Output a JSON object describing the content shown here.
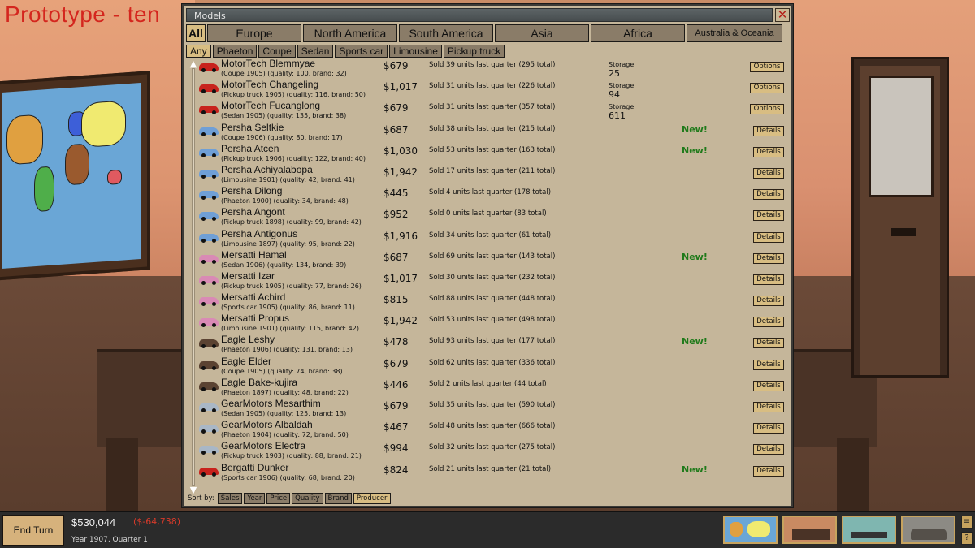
{
  "background_title": "Prototype - ten",
  "window": {
    "title": "Models",
    "close_symbol": "✕"
  },
  "regions": [
    {
      "label": "All",
      "active": true
    },
    {
      "label": "Europe",
      "active": false
    },
    {
      "label": "North America",
      "active": false
    },
    {
      "label": "South America",
      "active": false
    },
    {
      "label": "Asia",
      "active": false
    },
    {
      "label": "Africa",
      "active": false
    },
    {
      "label": "Australia & Oceania",
      "active": false
    }
  ],
  "types": [
    {
      "label": "Any",
      "active": true
    },
    {
      "label": "Phaeton",
      "active": false
    },
    {
      "label": "Coupe",
      "active": false
    },
    {
      "label": "Sedan",
      "active": false
    },
    {
      "label": "Sports car",
      "active": false
    },
    {
      "label": "Limousine",
      "active": false
    },
    {
      "label": "Pickup truck",
      "active": false
    }
  ],
  "scroll": {
    "up": "▲",
    "down": "▼"
  },
  "models": [
    {
      "name": "MotorTech Blemmyae",
      "sub": "(Coupe 1905)   (quality: 100, brand: 32)",
      "price": "$679",
      "sold": "Sold 39 units last quarter (295 total)",
      "storage_label": "Storage",
      "storage": "25",
      "new": "",
      "button": "Options",
      "icon_color": "#c8231d"
    },
    {
      "name": "MotorTech Changeling",
      "sub": "(Pickup truck 1905)   (quality: 116, brand: 50)",
      "price": "$1,017",
      "sold": "Sold 31 units last quarter (226 total)",
      "storage_label": "Storage",
      "storage": "94",
      "new": "",
      "button": "Options",
      "icon_color": "#c8231d"
    },
    {
      "name": "MotorTech Fucanglong",
      "sub": "(Sedan 1905)   (quality: 135, brand: 38)",
      "price": "$679",
      "sold": "Sold 31 units last quarter (357 total)",
      "storage_label": "Storage",
      "storage": "611",
      "new": "",
      "button": "Options",
      "icon_color": "#c8231d"
    },
    {
      "name": "Persha Seltkie",
      "sub": "(Coupe 1906)   (quality: 80, brand: 17)",
      "price": "$687",
      "sold": "Sold 38 units last quarter (215 total)",
      "storage_label": "",
      "storage": "",
      "new": "New!",
      "button": "Details",
      "icon_color": "#6f9fd6"
    },
    {
      "name": "Persha Atcen",
      "sub": "(Pickup truck 1906)   (quality: 122, brand: 40)",
      "price": "$1,030",
      "sold": "Sold 53 units last quarter (163 total)",
      "storage_label": "",
      "storage": "",
      "new": "New!",
      "button": "Details",
      "icon_color": "#6f9fd6"
    },
    {
      "name": "Persha Achiyalabopa",
      "sub": "(Limousine 1901)   (quality: 42, brand: 41)",
      "price": "$1,942",
      "sold": "Sold 17 units last quarter (211 total)",
      "storage_label": "",
      "storage": "",
      "new": "",
      "button": "Details",
      "icon_color": "#6f9fd6"
    },
    {
      "name": "Persha Dilong",
      "sub": "(Phaeton 1900)   (quality: 34, brand: 48)",
      "price": "$445",
      "sold": "Sold 4 units last quarter (178 total)",
      "storage_label": "",
      "storage": "",
      "new": "",
      "button": "Details",
      "icon_color": "#6f9fd6"
    },
    {
      "name": "Persha Angont",
      "sub": "(Pickup truck 1898)   (quality: 99, brand: 42)",
      "price": "$952",
      "sold": "Sold 0 units last quarter (83 total)",
      "storage_label": "",
      "storage": "",
      "new": "",
      "button": "Details",
      "icon_color": "#6f9fd6"
    },
    {
      "name": "Persha Antigonus",
      "sub": "(Limousine 1897)   (quality: 95, brand: 22)",
      "price": "$1,916",
      "sold": "Sold 34 units last quarter (61 total)",
      "storage_label": "",
      "storage": "",
      "new": "",
      "button": "Details",
      "icon_color": "#6f9fd6"
    },
    {
      "name": "Mersatti Hamal",
      "sub": "(Sedan 1906)   (quality: 134, brand: 39)",
      "price": "$687",
      "sold": "Sold 69 units last quarter (143 total)",
      "storage_label": "",
      "storage": "",
      "new": "New!",
      "button": "Details",
      "icon_color": "#d98ab5"
    },
    {
      "name": "Mersatti Izar",
      "sub": "(Pickup truck 1905)   (quality: 77, brand: 26)",
      "price": "$1,017",
      "sold": "Sold 30 units last quarter (232 total)",
      "storage_label": "",
      "storage": "",
      "new": "",
      "button": "Details",
      "icon_color": "#d98ab5"
    },
    {
      "name": "Mersatti Achird",
      "sub": "(Sports car 1905)   (quality: 86, brand: 11)",
      "price": "$815",
      "sold": "Sold 88 units last quarter (448 total)",
      "storage_label": "",
      "storage": "",
      "new": "",
      "button": "Details",
      "icon_color": "#d98ab5"
    },
    {
      "name": "Mersatti Propus",
      "sub": "(Limousine 1901)   (quality: 115, brand: 42)",
      "price": "$1,942",
      "sold": "Sold 53 units last quarter (498 total)",
      "storage_label": "",
      "storage": "",
      "new": "",
      "button": "Details",
      "icon_color": "#d98ab5"
    },
    {
      "name": "Eagle Leshy",
      "sub": "(Phaeton 1906)   (quality: 131, brand: 13)",
      "price": "$478",
      "sold": "Sold 93 units last quarter (177 total)",
      "storage_label": "",
      "storage": "",
      "new": "New!",
      "button": "Details",
      "icon_color": "#5b4332"
    },
    {
      "name": "Eagle Elder",
      "sub": "(Coupe 1905)   (quality: 74, brand: 38)",
      "price": "$679",
      "sold": "Sold 62 units last quarter (336 total)",
      "storage_label": "",
      "storage": "",
      "new": "",
      "button": "Details",
      "icon_color": "#5b4332"
    },
    {
      "name": "Eagle Bake-kujira",
      "sub": "(Phaeton 1897)   (quality: 48, brand: 22)",
      "price": "$446",
      "sold": "Sold 2 units last quarter (44 total)",
      "storage_label": "",
      "storage": "",
      "new": "",
      "button": "Details",
      "icon_color": "#5b4332"
    },
    {
      "name": "GearMotors Mesarthim",
      "sub": "(Sedan 1905)   (quality: 125, brand: 13)",
      "price": "$679",
      "sold": "Sold 35 units last quarter (590 total)",
      "storage_label": "",
      "storage": "",
      "new": "",
      "button": "Details",
      "icon_color": "#a9b7c6"
    },
    {
      "name": "GearMotors Albaldah",
      "sub": "(Phaeton 1904)   (quality: 72, brand: 50)",
      "price": "$467",
      "sold": "Sold 48 units last quarter (666 total)",
      "storage_label": "",
      "storage": "",
      "new": "",
      "button": "Details",
      "icon_color": "#a9b7c6"
    },
    {
      "name": "GearMotors Electra",
      "sub": "(Pickup truck 1903)   (quality: 88, brand: 21)",
      "price": "$994",
      "sold": "Sold 32 units last quarter (275 total)",
      "storage_label": "",
      "storage": "",
      "new": "",
      "button": "Details",
      "icon_color": "#a9b7c6"
    },
    {
      "name": "Bergatti Dunker",
      "sub": "(Sports car 1906)   (quality: 68, brand: 20)",
      "price": "$824",
      "sold": "Sold 21 units last quarter (21 total)",
      "storage_label": "",
      "storage": "",
      "new": "New!",
      "button": "Details",
      "icon_color": "#c8231d"
    }
  ],
  "sort": {
    "label": "Sort by:",
    "options": [
      {
        "label": "Sales",
        "active": false
      },
      {
        "label": "Year",
        "active": false
      },
      {
        "label": "Price",
        "active": false
      },
      {
        "label": "Quality",
        "active": false
      },
      {
        "label": "Brand",
        "active": false
      },
      {
        "label": "Producer",
        "active": true
      }
    ]
  },
  "bottom": {
    "end_turn": "End Turn",
    "money": "$530,044",
    "delta": "($-64,738)",
    "date": "Year 1907, Quarter 1",
    "mini_top": "≡",
    "mini_bottom": "?"
  }
}
